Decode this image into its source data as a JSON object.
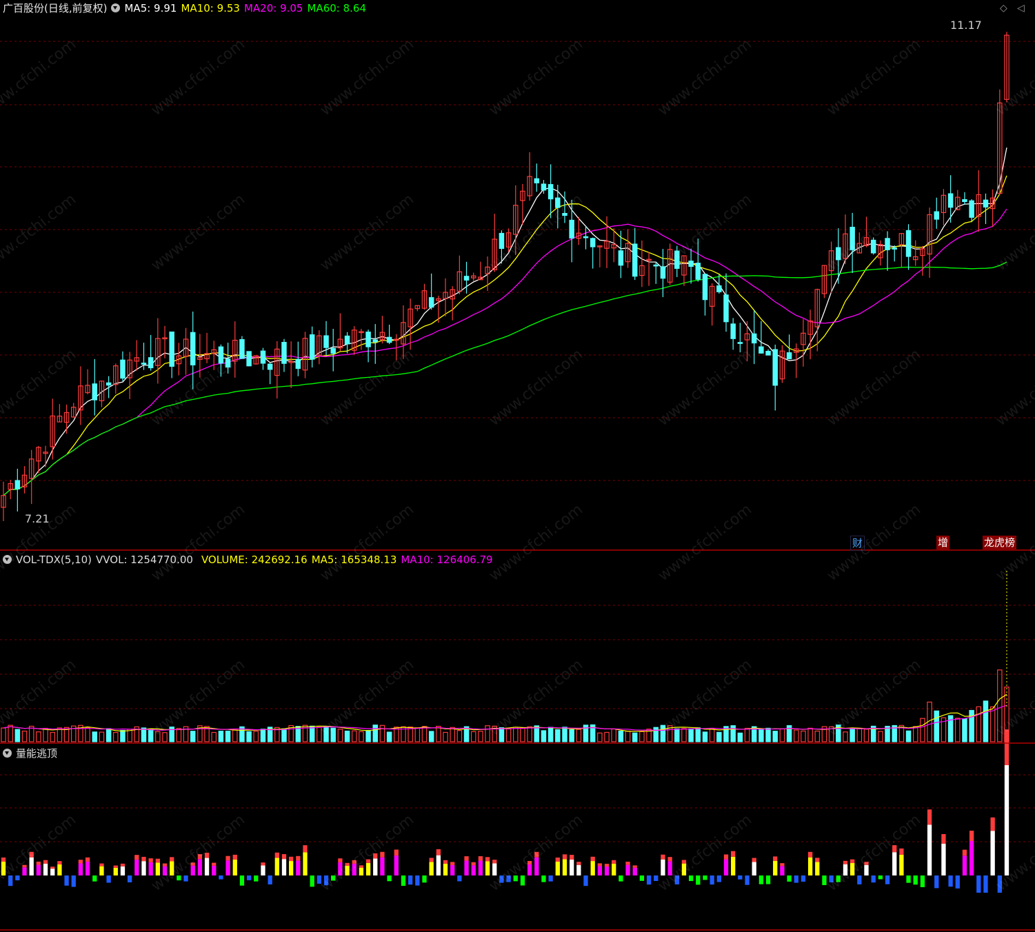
{
  "main_header": {
    "title": "广百股份(日线,前复权)",
    "ma5": "MA5: 9.91",
    "ma10": "MA10: 9.53",
    "ma20": "MA20: 9.05",
    "ma60": "MA60: 8.64"
  },
  "vol_header": {
    "name": "VOL-TDX(5,10)",
    "vvol": "VVOL: 1254770.00",
    "volume": "VOLUME: 242692.16",
    "ma5": "MA5: 165348.13",
    "ma10": "MA10: 126406.79"
  },
  "ind_header": {
    "name": "量能逃顶"
  },
  "price_labels": {
    "high": "11.17",
    "low": "7.21"
  },
  "event_tags": [
    {
      "text": "财",
      "color": "#4fa4ff"
    },
    {
      "text": "增",
      "color": "#ff4040"
    },
    {
      "text": "龙虎榜",
      "color": "#ff4040"
    }
  ],
  "watermark": "www.cfchi.com",
  "colors": {
    "up": "#ff3c3c",
    "down": "#54fcfc",
    "ma5": "#ffffff",
    "ma10": "#ffff00",
    "ma20": "#ff00ff",
    "ma60": "#00ff00",
    "grid": "#7a0000",
    "border": "#b40000"
  },
  "chart_data": {
    "type": "candlestick",
    "candle_count": 120,
    "price_range": [
      7.21,
      11.17
    ],
    "key_points": [
      {
        "i": 0,
        "close": 7.3
      },
      {
        "i": 10,
        "close": 8.1
      },
      {
        "i": 20,
        "close": 8.5
      },
      {
        "i": 40,
        "close": 8.45
      },
      {
        "i": 55,
        "close": 8.7
      },
      {
        "i": 68,
        "close": 9.2
      },
      {
        "i": 75,
        "close": 9.85
      },
      {
        "i": 88,
        "close": 9.3
      },
      {
        "i": 98,
        "close": 9.2
      },
      {
        "i": 110,
        "close": 8.3
      },
      {
        "i": 120,
        "close": 9.5
      },
      {
        "i": 130,
        "close": 9.4
      },
      {
        "i": 134,
        "close": 9.85
      },
      {
        "i": 142,
        "close": 9.7
      },
      {
        "i": 143,
        "close": 11.17
      }
    ],
    "last_values": {
      "ma5": 9.91,
      "ma10": 9.53,
      "ma20": 9.05,
      "ma60": 8.64
    },
    "volume_last": 242692.16,
    "volume_ma5": 165348.13,
    "volume_ma10": 126406.79,
    "vvol": 1254770.0
  }
}
